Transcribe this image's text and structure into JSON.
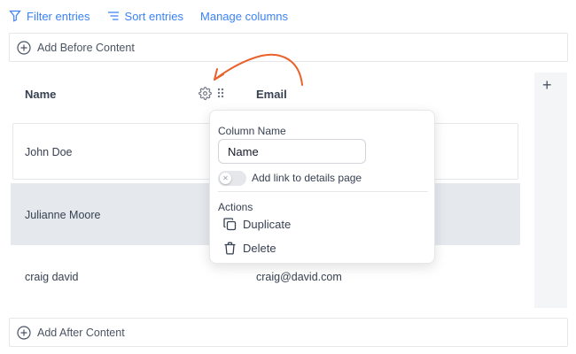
{
  "toolbar": {
    "filter_label": "Filter entries",
    "sort_label": "Sort entries",
    "manage_label": "Manage columns"
  },
  "add_before_label": "Add Before Content",
  "add_after_label": "Add After Content",
  "columns": {
    "name_header": "Name",
    "email_header": "Email"
  },
  "rows": [
    {
      "name": "John Doe",
      "email": ""
    },
    {
      "name": "Julianne Moore",
      "email": ""
    },
    {
      "name": "craig david",
      "email": "craig@david.com"
    }
  ],
  "side_panel": {
    "add_symbol": "+"
  },
  "popover": {
    "column_name_label": "Column Name",
    "column_name_value": "Name",
    "link_toggle_label": "Add link to details page",
    "link_toggle_on": false,
    "actions_label": "Actions",
    "duplicate_label": "Duplicate",
    "delete_label": "Delete"
  },
  "colors": {
    "accent": "#3b82f6",
    "annotation_arrow": "#e8622a",
    "highlight_row": "#e5e9ee"
  }
}
